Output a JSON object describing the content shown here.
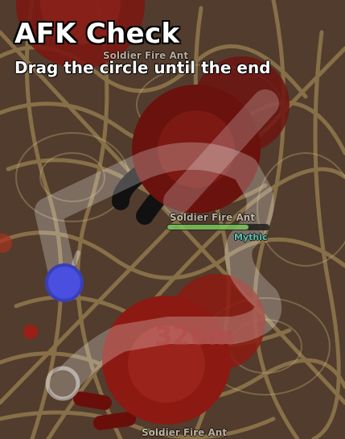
{
  "dialog": {
    "title": "AFK Check",
    "instruction": "Drag the circle until the end"
  },
  "mobs": [
    {
      "name": "Soldier Fire Ant"
    },
    {
      "name": "Soldier Fire Ant",
      "rarity": "Mythic",
      "health_fraction": 0.8
    },
    {
      "name": "Soldier Fire Ant"
    }
  ],
  "score_text": "326m",
  "colors": {
    "ground": "#5a4232",
    "web": "#b39a5f",
    "ant_body": "#8c1a12",
    "ant_dark": "#5a0f0a",
    "drag_handle": "#4a4fe0",
    "path": "#ffffff",
    "rarity_mythic": "#4fd6c4"
  },
  "icons": {
    "handle": "drag-circle-icon",
    "goal": "end-ring-icon"
  }
}
